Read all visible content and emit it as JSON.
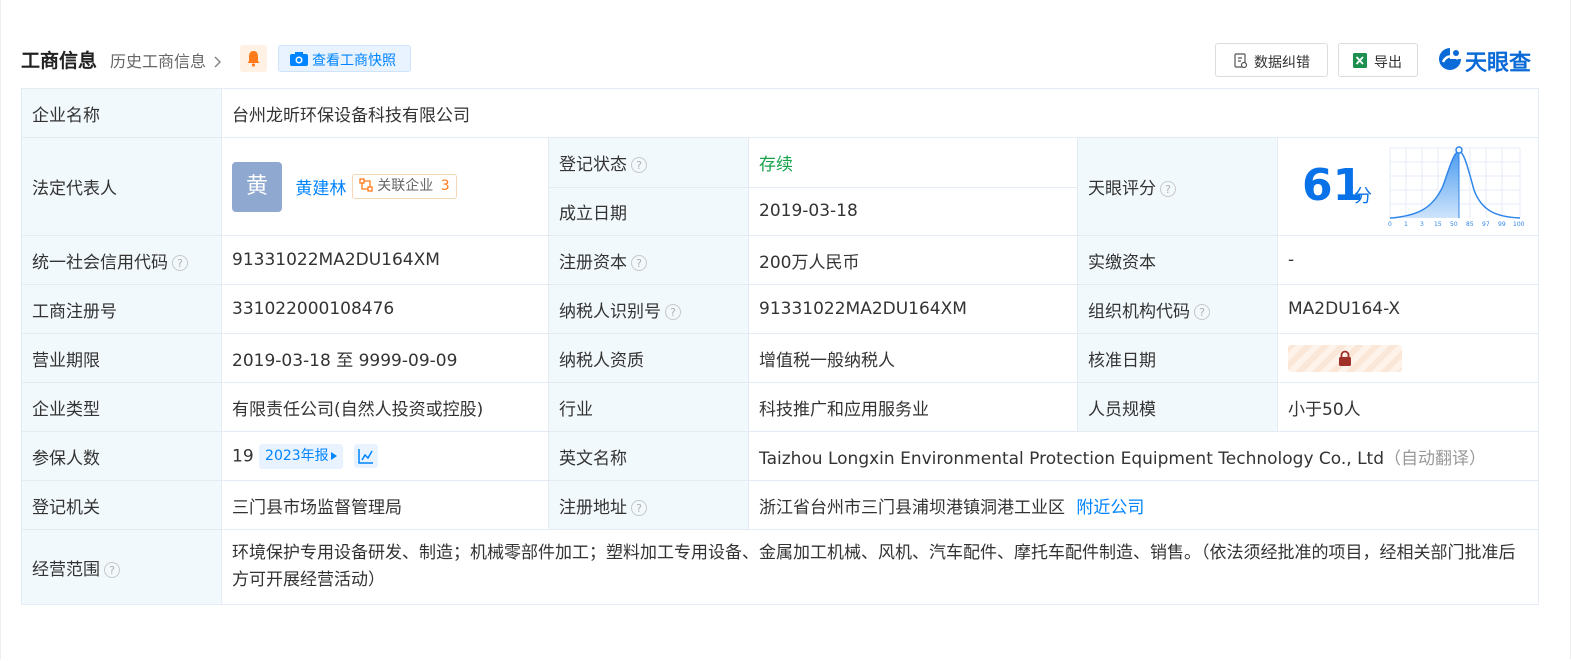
{
  "header": {
    "title": "工商信息",
    "history_link": "历史工商信息",
    "snapshot_button": "查看工商快照",
    "correct_button": "数据纠错",
    "export_button": "导出",
    "logo_text": "天眼查"
  },
  "company": {
    "name_label": "企业名称",
    "name": "台州龙昕环保设备科技有限公司",
    "legal_rep_label": "法定代表人",
    "legal_rep_avatar": "黄",
    "legal_rep_name": "黄建林",
    "related_label": "关联企业",
    "related_count": "3",
    "status_label": "登记状态",
    "status": "存续",
    "founded_label": "成立日期",
    "founded": "2019-03-18",
    "score_label": "天眼评分",
    "score": "61",
    "score_unit": "分",
    "credit_code_label": "统一社会信用代码",
    "credit_code": "91331022MA2DU164XM",
    "reg_capital_label": "注册资本",
    "reg_capital": "200万人民币",
    "paid_capital_label": "实缴资本",
    "paid_capital": "-",
    "reg_no_label": "工商注册号",
    "reg_no": "331022000108476",
    "taxpayer_id_label": "纳税人识别号",
    "taxpayer_id": "91331022MA2DU164XM",
    "org_code_label": "组织机构代码",
    "org_code": "MA2DU164-X",
    "term_label": "营业期限",
    "term": "2019-03-18 至 9999-09-09",
    "taxpayer_qual_label": "纳税人资质",
    "taxpayer_qual": "增值税一般纳税人",
    "approval_date_label": "核准日期",
    "type_label": "企业类型",
    "type": "有限责任公司(自然人投资或控股)",
    "industry_label": "行业",
    "industry": "科技推广和应用服务业",
    "staff_size_label": "人员规模",
    "staff_size": "小于50人",
    "insured_label": "参保人数",
    "insured": "19",
    "insured_report": "2023年报",
    "english_name_label": "英文名称",
    "english_name": "Taizhou Longxin Environmental Protection Equipment Technology Co., Ltd",
    "auto_translate": "（自动翻译）",
    "authority_label": "登记机关",
    "authority": "三门县市场监督管理局",
    "address_label": "注册地址",
    "address": "浙江省台州市三门县浦坝港镇洞港工业区",
    "nearby_link": "附近公司",
    "scope_label": "经营范围",
    "scope": "环境保护专用设备研发、制造；机械零部件加工；塑料加工专用设备、金属加工机械、风机、汽车配件、摩托车配件制造、销售。（依法须经批准的项目，经相关部门批准后方可开展经营活动）"
  },
  "score_chart": {
    "ticks": [
      "0",
      "1",
      "3",
      "15",
      "50",
      "85",
      "97",
      "99",
      "100"
    ]
  }
}
